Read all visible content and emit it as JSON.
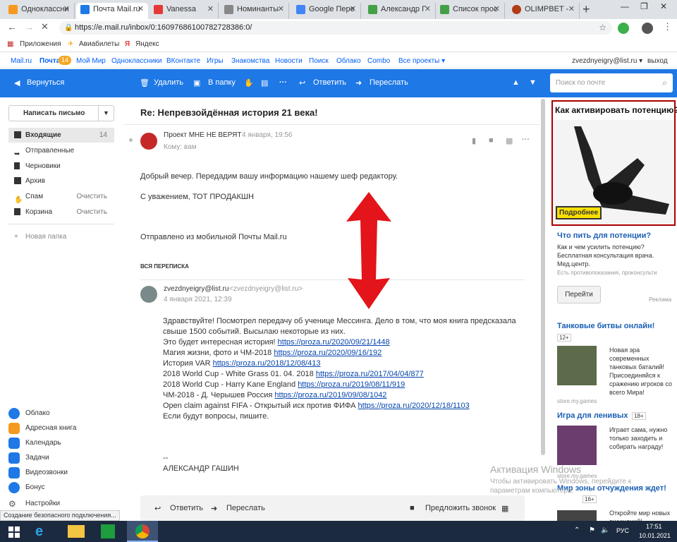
{
  "browser": {
    "tabs": [
      {
        "label": "Одноклассни",
        "color": "#f59a1e"
      },
      {
        "label": "Почта Mail.ru",
        "color": "#1e78e6",
        "active": true
      },
      {
        "label": "Vanessa",
        "color": "#e53935"
      },
      {
        "label": "Номинанты",
        "color": "#888"
      },
      {
        "label": "Google Пере",
        "color": "#4285f4"
      },
      {
        "label": "Александр Г",
        "color": "#43a047"
      },
      {
        "label": "Список прос",
        "color": "#43a047"
      },
      {
        "label": "OLIMPBET - ",
        "color": "#b23c17"
      }
    ],
    "url": "https://e.mail.ru/inbox/0:16097686100782728386:0/",
    "bookmarks": [
      "Приложения",
      "Авиабилеты",
      "Яндекс"
    ]
  },
  "portal": {
    "links": [
      "Mail.ru",
      "Почта",
      "Мой Мир",
      "Одноклассники",
      "ВКонтакте",
      "Игры",
      "Знакомства",
      "Новости",
      "Поиск",
      "Облако",
      "Combo",
      "Все проекты ▾"
    ],
    "mail_badge": "14",
    "user": "zvezdnyeigry@list.ru ▾",
    "logout": "выход"
  },
  "toolbar": {
    "back": "Вернуться",
    "delete": "Удалить",
    "to_folder": "В папку",
    "reply": "Ответить",
    "forward": "Переслать",
    "more": "···",
    "search_placeholder": "Поиск по почте"
  },
  "sidebar": {
    "compose": "Написать письмо",
    "folders": [
      {
        "label": "Входящие",
        "count": "14"
      },
      {
        "label": "Отправленные",
        "count": ""
      },
      {
        "label": "Черновики",
        "count": ""
      },
      {
        "label": "Архив",
        "count": ""
      },
      {
        "label": "Спам",
        "count": "Очистить"
      },
      {
        "label": "Корзина",
        "count": "Очистить"
      }
    ],
    "new_folder": "Новая папка",
    "services": [
      {
        "label": "Облако",
        "color": "#1e78e6"
      },
      {
        "label": "Адресная книга",
        "color": "#f59a1e"
      },
      {
        "label": "Календарь",
        "color": "#1e78e6"
      },
      {
        "label": "Задачи",
        "color": "#1e78e6"
      },
      {
        "label": "Видеозвонки",
        "color": "#1e78e6"
      },
      {
        "label": "Бонус",
        "color": "#1e78e6"
      },
      {
        "label": "Настройки",
        "color": "#555"
      }
    ]
  },
  "message": {
    "subject": "Re: Непревзойдённая история 21 века!",
    "from": "Проект МНЕ НЕ ВЕРЯТ",
    "date": "4 января, 19:56",
    "to": "Кому: вам",
    "body1": "Добрый вечер. Передадим вашу информацию нашему шеф редактору.",
    "body2": "С уважением, ТОТ ПРОДАКШН",
    "body3": "Отправлено из мобильной Почты Mail.ru",
    "thread_label": "ВСЯ ПЕРЕПИСКА",
    "quoted_from": "zvezdnyeigry@list.ru",
    "quoted_email": "<zvezdnyeigry@list.ru>",
    "quoted_date": "4 января 2021, 12:39",
    "quoted_lines": [
      {
        "text": "Здравствуйте! Посмотрел передачу об ученице Мессинга. Дело в том, что моя книга предсказала",
        "link": ""
      },
      {
        "text": "свыше 1500 событий. Высылаю некоторые из них.",
        "link": ""
      },
      {
        "text": "Это будет интересная история! ",
        "link": "https://proza.ru/2020/09/21/1448"
      },
      {
        "text": "Магия жизни, фото и ЧМ-2018 ",
        "link": "https://proza.ru/2020/09/16/192"
      },
      {
        "text": "История VAR ",
        "link": "https://proza.ru/2018/12/08/413"
      },
      {
        "text": "2018 World Cup - White Grass 01. 04. 2018 ",
        "link": "https://proza.ru/2017/04/04/877"
      },
      {
        "text": "2018 World Cup - Harry Kane England ",
        "link": "https://proza.ru/2019/08/11/919"
      },
      {
        "text": "ЧМ-2018 - Д. Черышев Россия ",
        "link": "https://proza.ru/2019/09/08/1042"
      },
      {
        "text": "Open claim against FIFA - Открытый иск против ФИФА ",
        "link": "https://proza.ru/2020/12/18/1103"
      },
      {
        "text": "Если будут вопросы, пишите.",
        "link": ""
      }
    ],
    "sig_dash": "--",
    "signature": "АЛЕКСАНДР ГАШИН",
    "bottom_reply": "Ответить",
    "bottom_forward": "Переслать",
    "bottom_call": "Предложить звонок"
  },
  "ads": {
    "banner_title": "Как активировать потенцию?",
    "banner_button": "Подробнее",
    "ad1_title": "Что пить для потенции?",
    "ad1_text1": "Как и чем усилить потенцию?",
    "ad1_text2": "Бесплатная консультация врача.",
    "ad1_text3": "Мед.центр.",
    "ad1_warn": "Есть противопоказания, проконсульти",
    "ad1_button": "Перейти",
    "ad_label": "Реклама",
    "ad2_title": "Танковые битвы онлайн!",
    "ad2_age": "12+",
    "ad2_text": "Новая эра современных танковых баталий! Присоединяйся к сражению игроков со всего Мира!",
    "ad2_source": "store.my.games",
    "ad3_title": "Игра для ленивых",
    "ad3_age": "18+",
    "ad3_text": "Играет сама, нужно только заходить и собирать награду!",
    "ad3_source": "store.my.games",
    "ad4_title": "Мир зоны отчуждения ждет!",
    "ad4_age": "16+",
    "ad4_text": "Откройте мир новых ощущений!"
  },
  "status_text": "Создание безопасного подключения...",
  "watermark": {
    "title": "Активация Windows",
    "text1": "Чтобы активировать Windows, перейдите к",
    "text2": "параметрам компьютера."
  },
  "taskbar": {
    "lang": "РУС",
    "time": "17:51",
    "date": "10.01.2021"
  }
}
